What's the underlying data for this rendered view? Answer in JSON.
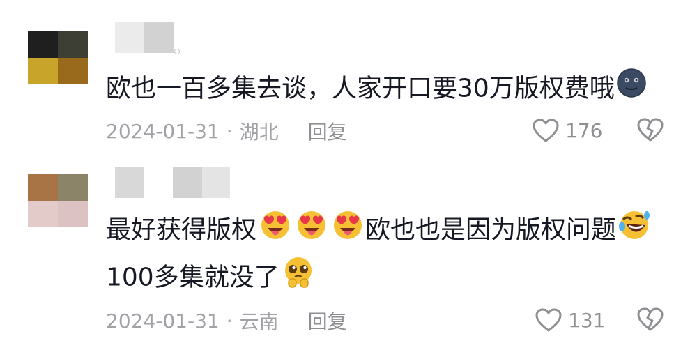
{
  "comments": [
    {
      "text": "欧也一百多集去谈，人家开口要30万版权费哦",
      "emoji": "new-moon-face-emoji",
      "date": "2024-01-31",
      "location": "湖北",
      "reply_label": "回复",
      "likes": "176"
    },
    {
      "text_line1": "最好获得版权",
      "text_line1_after": "欧也也是因为版权问题",
      "text_line2": "100多集就没了",
      "emoji_hearts": "heart-eyes-emoji",
      "emoji_laugh": "rolling-laughing-emoji",
      "emoji_plead": "pleading-emoji",
      "date": "2024-01-31",
      "location": "云南",
      "reply_label": "回复",
      "likes": "131"
    }
  ],
  "separator": "·",
  "colors": {
    "text": "#161823",
    "meta": "#a1a1a7",
    "icon": "#8e8e93"
  }
}
